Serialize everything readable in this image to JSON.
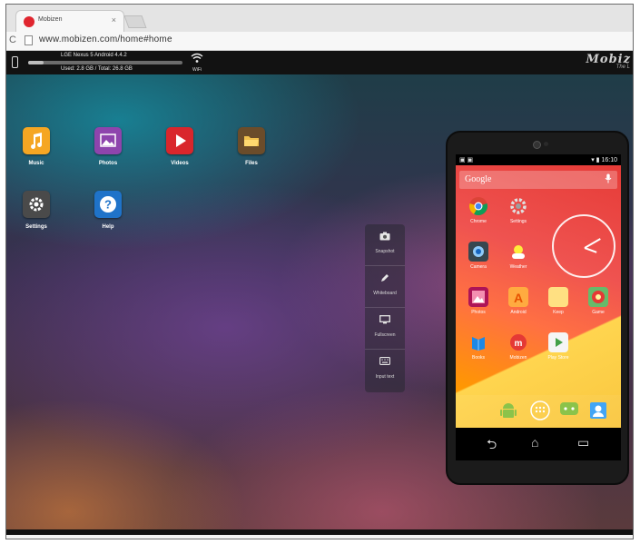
{
  "browser": {
    "tab_title": "Mobizen",
    "tab_close": "×",
    "url": "www.mobizen.com/home#home",
    "reload_glyph": "C"
  },
  "mobizen_bar": {
    "device_model": "LGE Nexus 5 Android 4.4.2",
    "storage_text": "Used: 2.8 GB / Total: 26.8 GB",
    "storage_used_fraction": 0.1,
    "wifi_label": "WiFi",
    "logo_text": "Mobiz",
    "tagline": "The L"
  },
  "desktop_apps": [
    {
      "label": "Music",
      "icon": "music-icon",
      "color": "#f5a623"
    },
    {
      "label": "Photos",
      "icon": "photos-icon",
      "color": "#8e44ad"
    },
    {
      "label": "Videos",
      "icon": "videos-icon",
      "color": "#d9262c"
    },
    {
      "label": "Files",
      "icon": "files-icon",
      "color": "#6b4c2a"
    },
    {
      "label": "Settings",
      "icon": "settings-icon",
      "color": "#4a4a4a"
    },
    {
      "label": "Help",
      "icon": "help-icon",
      "color": "#1f73c9"
    }
  ],
  "toolbar": [
    {
      "label": "Snapshot",
      "icon": "camera-icon"
    },
    {
      "label": "Whiteboard",
      "icon": "pencil-icon"
    },
    {
      "label": "Fullscreen",
      "icon": "monitor-icon"
    },
    {
      "label": "Input text",
      "icon": "keyboard-icon"
    }
  ],
  "phone": {
    "status_left": "▣ ▣",
    "status_right": "▾ ▮ 16:10",
    "google_label": "Google",
    "mic_glyph": "🎙",
    "apps": [
      {
        "label": "Chrome",
        "color": "#e9e9e9"
      },
      {
        "label": "Settings",
        "color": "#9e9e9e"
      },
      {
        "label": "Camera",
        "color": "#3a3a3a"
      },
      {
        "label": "Weather",
        "color": "#f6b400"
      },
      {
        "label": "Photos",
        "color": "#d35bb0"
      },
      {
        "label": "Android",
        "color": "#ff7a2f"
      },
      {
        "label": "Keep",
        "color": "#ffe082"
      },
      {
        "label": "Game",
        "color": "#4caf50"
      },
      {
        "label": "Books",
        "color": "#1e88e5"
      },
      {
        "label": "Mobizen",
        "color": "#e53935"
      },
      {
        "label": "Play Store",
        "color": "#f5f5f5"
      }
    ],
    "nav": {
      "back": "⮌",
      "home": "⌂",
      "recent": "▭"
    }
  },
  "colors": {
    "chrome_bg": "#e4e4e4",
    "mobizen_bar": "#121212",
    "accent": "#e0262f"
  }
}
